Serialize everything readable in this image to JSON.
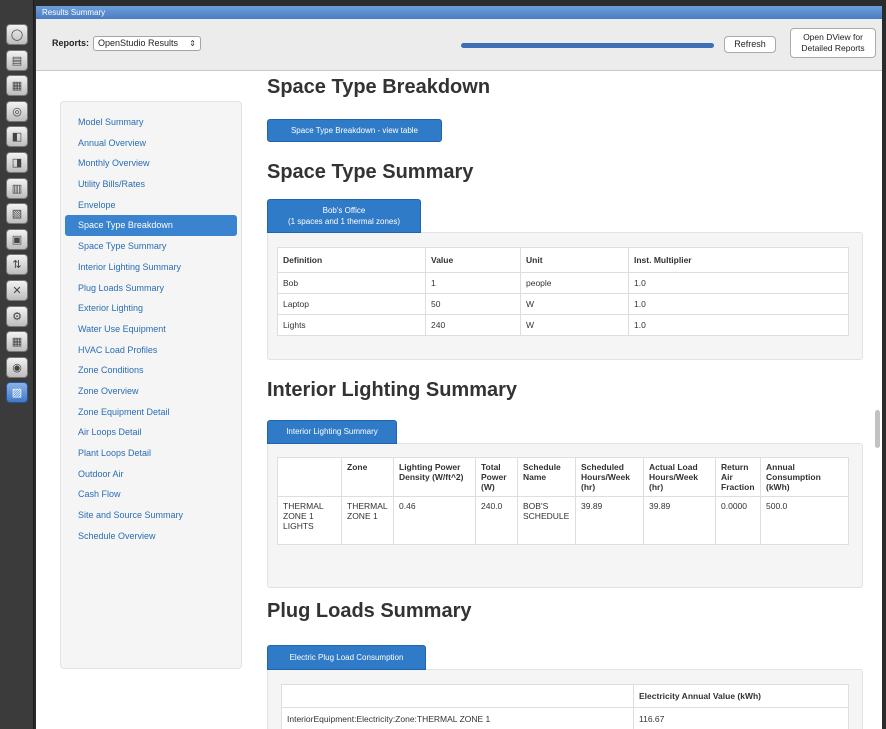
{
  "window": {
    "title": "Results Summary"
  },
  "reportbar": {
    "label": "Reports:",
    "selected_report": "OpenStudio Results",
    "progress_percent": 100,
    "refresh_label": "Refresh",
    "dview_line1": "Open DView for",
    "dview_line2": "Detailed Reports"
  },
  "toolbar": {
    "icons": [
      "site-icon",
      "building-icon",
      "loads-icon",
      "space-types-icon",
      "geometry-icon",
      "facility-icon",
      "spaces-icon",
      "thermal-zones-icon",
      "hvac-icon",
      "outputs-icon",
      "measures-icon",
      "run-icon",
      "results-icon",
      "scripts-icon",
      "summary-icon"
    ]
  },
  "sidebar": {
    "items": [
      "Model Summary",
      "Annual Overview",
      "Monthly Overview",
      "Utility Bills/Rates",
      "Envelope",
      "Space Type Breakdown",
      "Space Type Summary",
      "Interior Lighting Summary",
      "Plug Loads Summary",
      "Exterior Lighting",
      "Water Use Equipment",
      "HVAC Load Profiles",
      "Zone Conditions",
      "Zone Overview",
      "Zone Equipment Detail",
      "Air Loops Detail",
      "Plant Loops Detail",
      "Outdoor Air",
      "Cash Flow",
      "Site and Source Summary",
      "Schedule Overview"
    ],
    "active_index": 5
  },
  "sections": {
    "breakdown": {
      "title": "Space Type Breakdown",
      "button": "Space Type Breakdown - view table"
    },
    "space_type_summary": {
      "title": "Space Type Summary",
      "tab_line1": "Bob's Office",
      "tab_line2": "(1 spaces and 1 thermal zones)",
      "headers": [
        "Definition",
        "Value",
        "Unit",
        "Inst. Multiplier"
      ],
      "rows": [
        [
          "Bob",
          "1",
          "people",
          "1.0"
        ],
        [
          "Laptop",
          "50",
          "W",
          "1.0"
        ],
        [
          "Lights",
          "240",
          "W",
          "1.0"
        ]
      ]
    },
    "interior_lighting": {
      "title": "Interior Lighting Summary",
      "tab": "Interior Lighting Summary",
      "headers": [
        "",
        "Zone",
        "Lighting Power Density (W/ft^2)",
        "Total Power (W)",
        "Schedule Name",
        "Scheduled Hours/Week (hr)",
        "Actual Load Hours/Week (hr)",
        "Return Air Fraction",
        "Annual Consumption (kWh)"
      ],
      "rows": [
        [
          "THERMAL ZONE 1 LIGHTS",
          "THERMAL ZONE 1",
          "0.46",
          "240.0",
          "BOB'S SCHEDULE",
          "39.89",
          "39.89",
          "0.0000",
          "500.0"
        ]
      ]
    },
    "plug_loads": {
      "title": "Plug Loads Summary",
      "tab": "Electric Plug Load Consumption",
      "headers": [
        "",
        "Electricity Annual Value (kWh)"
      ],
      "rows": [
        [
          "InteriorEquipment:Electricity:Zone:THERMAL ZONE 1",
          "116.67"
        ]
      ]
    }
  }
}
